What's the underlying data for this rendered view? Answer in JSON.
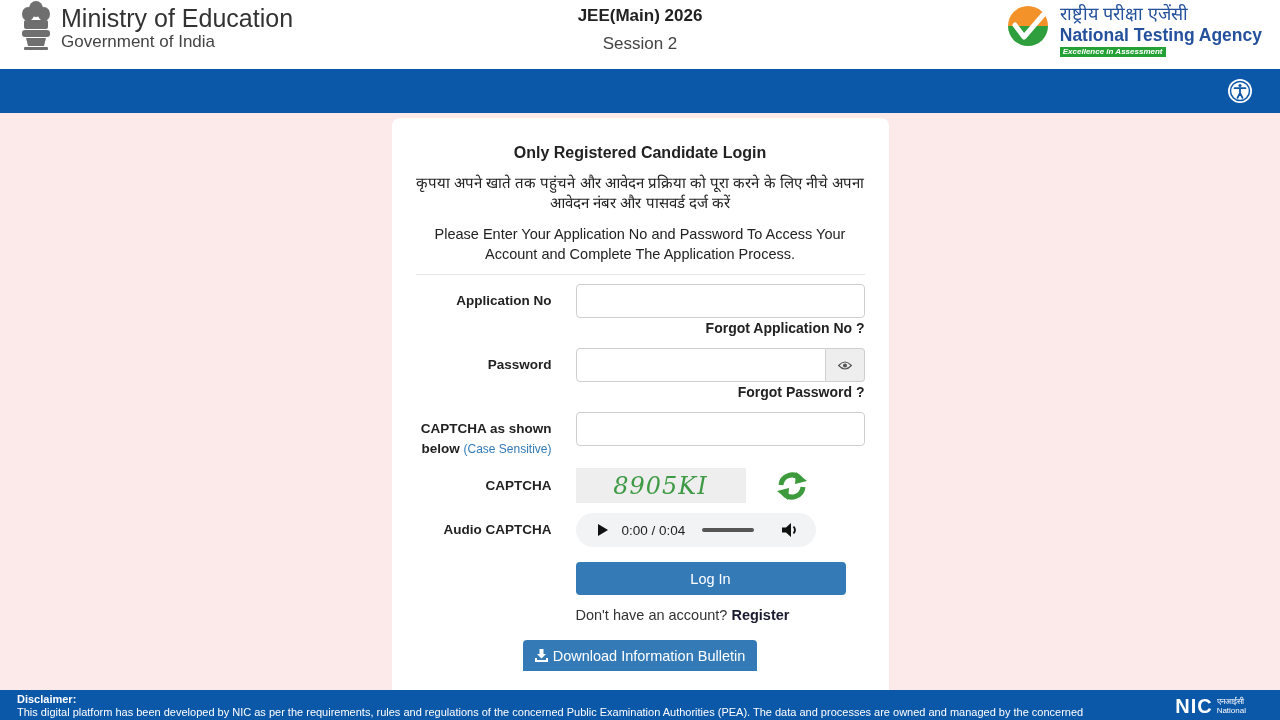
{
  "header": {
    "ministry": {
      "title": "Ministry of Education",
      "subtitle": "Government of India"
    },
    "exam": {
      "title": "JEE(Main) 2026",
      "session": "Session 2"
    },
    "agency": {
      "hindi_name": "राष्ट्रीय परीक्षा एजेंसी",
      "name": "National Testing Agency",
      "tagline": "Excellence in Assessment"
    }
  },
  "login_card": {
    "title": "Only Registered Candidate Login",
    "hindi_instructions": "कृपया अपने खाते तक पहुंचने और आवेदन प्रक्रिया को पूरा करने के लिए नीचे अपना आवेदन नंबर और पासवर्ड दर्ज करें",
    "instructions": "Please Enter Your Application No and Password To Access Your Account and Complete The Application Process.",
    "fields": [
      {
        "kind": "text",
        "label": "Application No",
        "link": "Forgot Application No ?"
      },
      {
        "kind": "password",
        "label": "Password",
        "link": "Forgot Password ?"
      },
      {
        "kind": "text",
        "label": "CAPTCHA as shown below",
        "note": "(Case Sensitive)"
      }
    ],
    "captcha": {
      "label": "CAPTCHA",
      "code": "8905KI"
    },
    "audio_captcha": {
      "label": "Audio CAPTCHA",
      "time": "0:00 / 0:04"
    },
    "login_button": "Log In",
    "register_prompt": "Don't have an account?",
    "register_link": "Register",
    "download_button": "Download Information Bulletin"
  },
  "footer": {
    "heading": "Disclaimer:",
    "text": "This digital platform has been developed by NIC as per the requirements, rules and regulations of the concerned Public Examination Authorities (PEA). The data and processes are owned and managed by the concerned",
    "logo": {
      "letters": "NIC",
      "hindi": "एनआईसी",
      "name": "National"
    }
  }
}
